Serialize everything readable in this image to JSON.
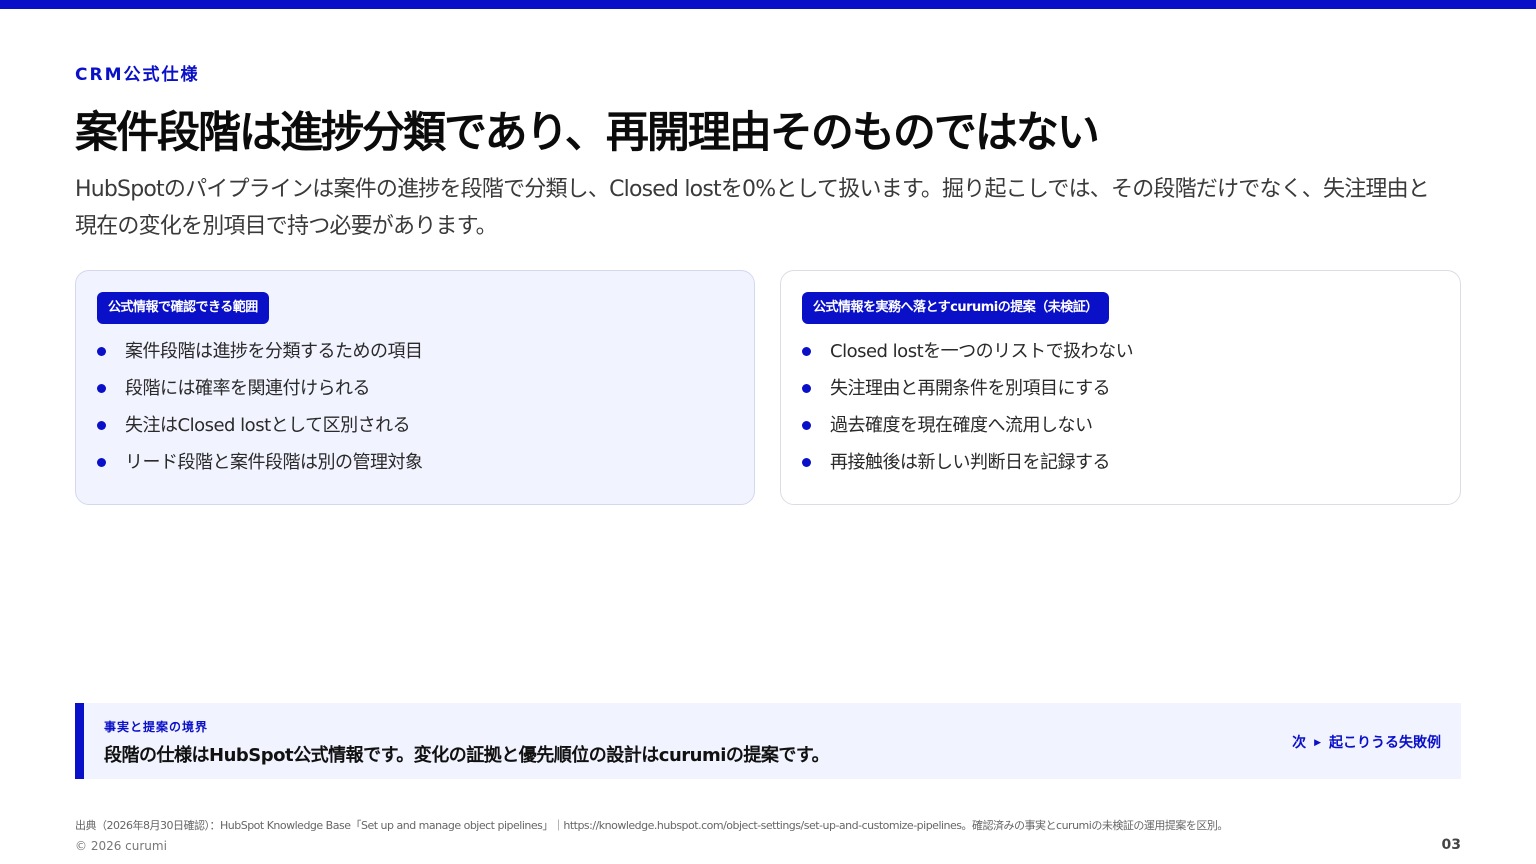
{
  "eyebrow": "CRM公式仕様",
  "title": "案件段階は進捗分類であり、再開理由そのものではない",
  "lead": "HubSpotのパイプラインは案件の進捗を段階で分類し、Closed lostを0%として扱います。掘り起こしでは、その段階だけでなく、失注理由と現在の変化を別項目で持つ必要があります。",
  "left_card": {
    "badge": "公式情報で確認できる範囲",
    "items": [
      "案件段階は進捗を分類するための項目",
      "段階には確率を関連付けられる",
      "失注はClosed lostとして区別される",
      "リード段階と案件段階は別の管理対象"
    ]
  },
  "right_card": {
    "badge": "公式情報を実務へ落とすcurumiの提案（未検証）",
    "items": [
      "Closed lostを一つのリストで扱わない",
      "失注理由と再開条件を別項目にする",
      "過去確度を現在確度へ流用しない",
      "再接触後は新しい判断日を記録する"
    ]
  },
  "callout": {
    "label": "事実と提案の境界",
    "text": "段階の仕様はHubSpot公式情報です。変化の証拠と優先順位の設計はcurumiの提案です。",
    "next_prefix": "次",
    "next_arrow": "▶",
    "next_label": "起こりうる失敗例"
  },
  "footer": {
    "source": "出典（2026年8月30日確認）：HubSpot Knowledge Base「Set up and manage object pipelines」｜https://knowledge.hubspot.com/object-settings/set-up-and-customize-pipelines。確認済みの事実とcurumiの未検証の運用提案を区別。",
    "copyright": "© 2026 curumi",
    "page": "03"
  },
  "colors": {
    "accent": "#0a0fc8",
    "panel": "#f1f3ff"
  }
}
